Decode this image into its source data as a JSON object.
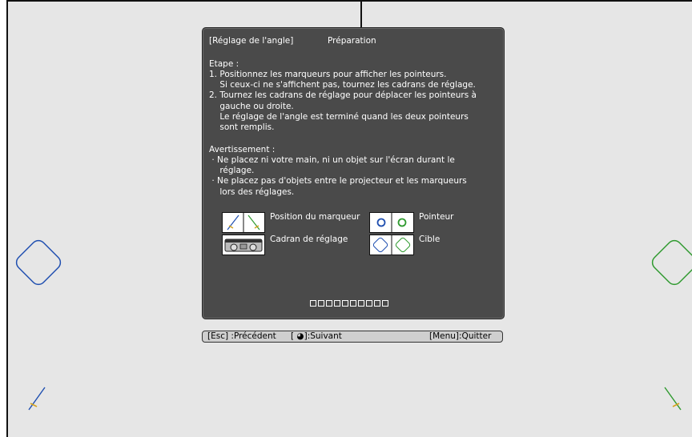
{
  "panel": {
    "title": "[Réglage de l'angle]",
    "subtitle": "Préparation",
    "steps_heading": "Etape :",
    "steps_text": "1. Positionnez les marqueurs pour afficher les pointeurs.\n    Si ceux-ci ne s'affichent pas, tournez les cadrans de réglage.\n2. Tournez les cadrans de réglage pour déplacer les pointeurs à\n    gauche ou droite.\n    Le réglage de l'angle est terminé quand les deux pointeurs\n    sont remplis.",
    "warning_heading": "Avertissement :",
    "warning_text": " · Ne placez ni votre main, ni un objet sur l'écran durant le\n    réglage.\n · Ne placez pas d'objets entre le projecteur et les marqueurs\n    lors des réglages.",
    "legend": {
      "marker_position": "Position du marqueur",
      "adjustment_dial": "Cadran de réglage",
      "pointer": "Pointeur",
      "target": "Cible"
    },
    "progress_count": 10
  },
  "footer": {
    "back": "[Esc] :Précédent",
    "next": "[ ◕]:Suivant",
    "quit": "[Menu]:Quitter"
  },
  "colors": {
    "blue": "#1f4fb0",
    "green": "#2f9a2f",
    "panel": "#4a4a4a",
    "screen": "#e6e6e6"
  }
}
